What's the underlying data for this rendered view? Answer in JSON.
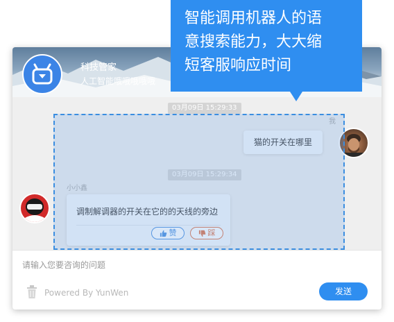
{
  "header": {
    "bot_name": "科技管家",
    "bot_status": "人工智能哦哦哦哦哦"
  },
  "conversation": {
    "timestamp_1": "03月09日 15:29:33",
    "user_label": "我",
    "user_message": "猫的开关在哪里",
    "timestamp_2": "03月09日 15:29:34",
    "bot_label": "小小鑫",
    "bot_message": "调制解调器的开关在它的的天线的旁边",
    "upvote_label": "赞",
    "downvote_label": "踩"
  },
  "footer": {
    "input_placeholder": "请输入您要咨询的问题",
    "powered_by": "Powered By YunWen",
    "send_label": "发送"
  },
  "callout": {
    "lines": [
      "智能调用机器人的语",
      "意搜索能力，大大缩",
      "短客服响应时间"
    ]
  },
  "icons": {
    "bot_avatar": "robot-icon",
    "trash": "trash-icon",
    "upvote": "thumbs-up-icon",
    "downvote": "thumbs-down-icon"
  },
  "colors": {
    "accent": "#2f8ef0",
    "upvote": "#4a8fe0",
    "downvote": "#e0744a",
    "highlight_border": "#3a8de0"
  }
}
